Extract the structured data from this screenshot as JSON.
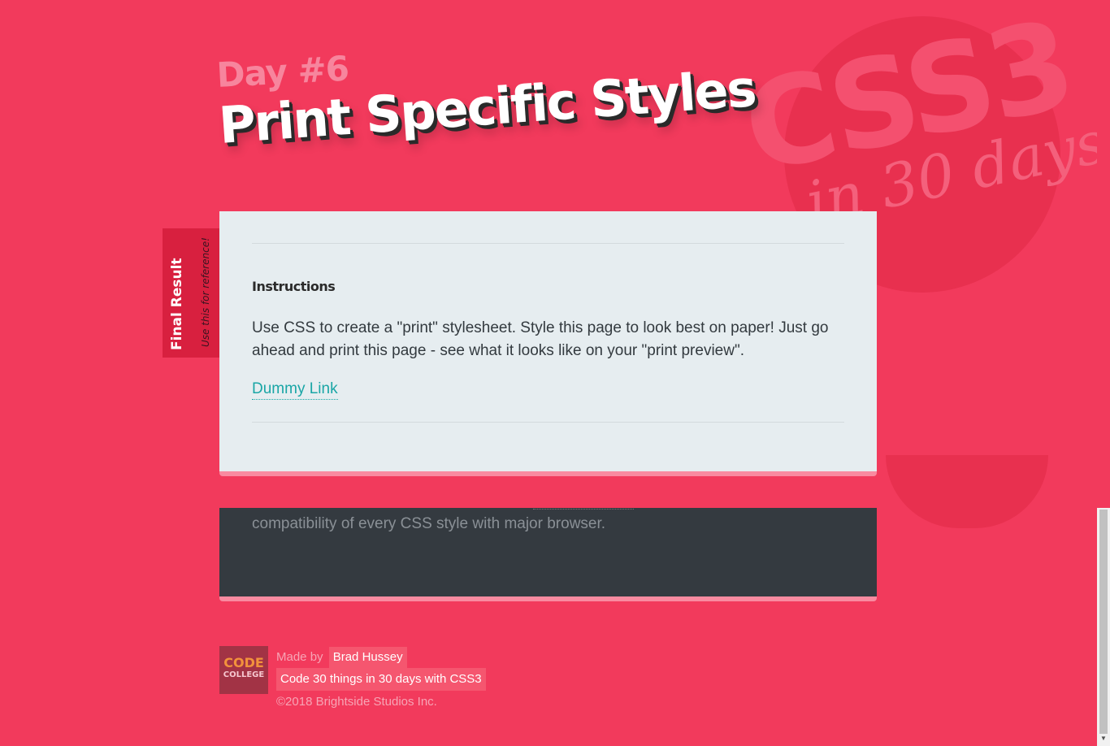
{
  "header": {
    "day_label": "Day #6",
    "title": "Print Specific Styles",
    "bg_logo_main": "CSS3",
    "bg_logo_sub": "in 30 days"
  },
  "side_tab": {
    "title": "Final Result",
    "subtitle": "Use this for reference!"
  },
  "card": {
    "heading": "Instructions",
    "body": "Use CSS to create a \"print\" stylesheet. Style this page to look best on paper! Just go ahead and print this page - see what it looks like on your \"print preview\".",
    "link_label": "Dummy Link"
  },
  "dark_box": {
    "text": "compatibility of every CSS style with major browser."
  },
  "footer": {
    "logo_line1": "CODE",
    "logo_line2": "COLLEGE",
    "made_by": "Made by",
    "author": "Brad Hussey",
    "course": "Code 30 things in 30 days with CSS3",
    "copyright": "©2018 Brightside Studios Inc."
  },
  "colors": {
    "background": "#f23a5c",
    "card": "#e6edf0",
    "dark_box": "#343a40",
    "link": "#1aa6a6",
    "accent_border": "#f98aa0"
  },
  "scrollbar": {
    "up_icon": "arrow-up-icon",
    "down_icon": "arrow-down-icon"
  }
}
